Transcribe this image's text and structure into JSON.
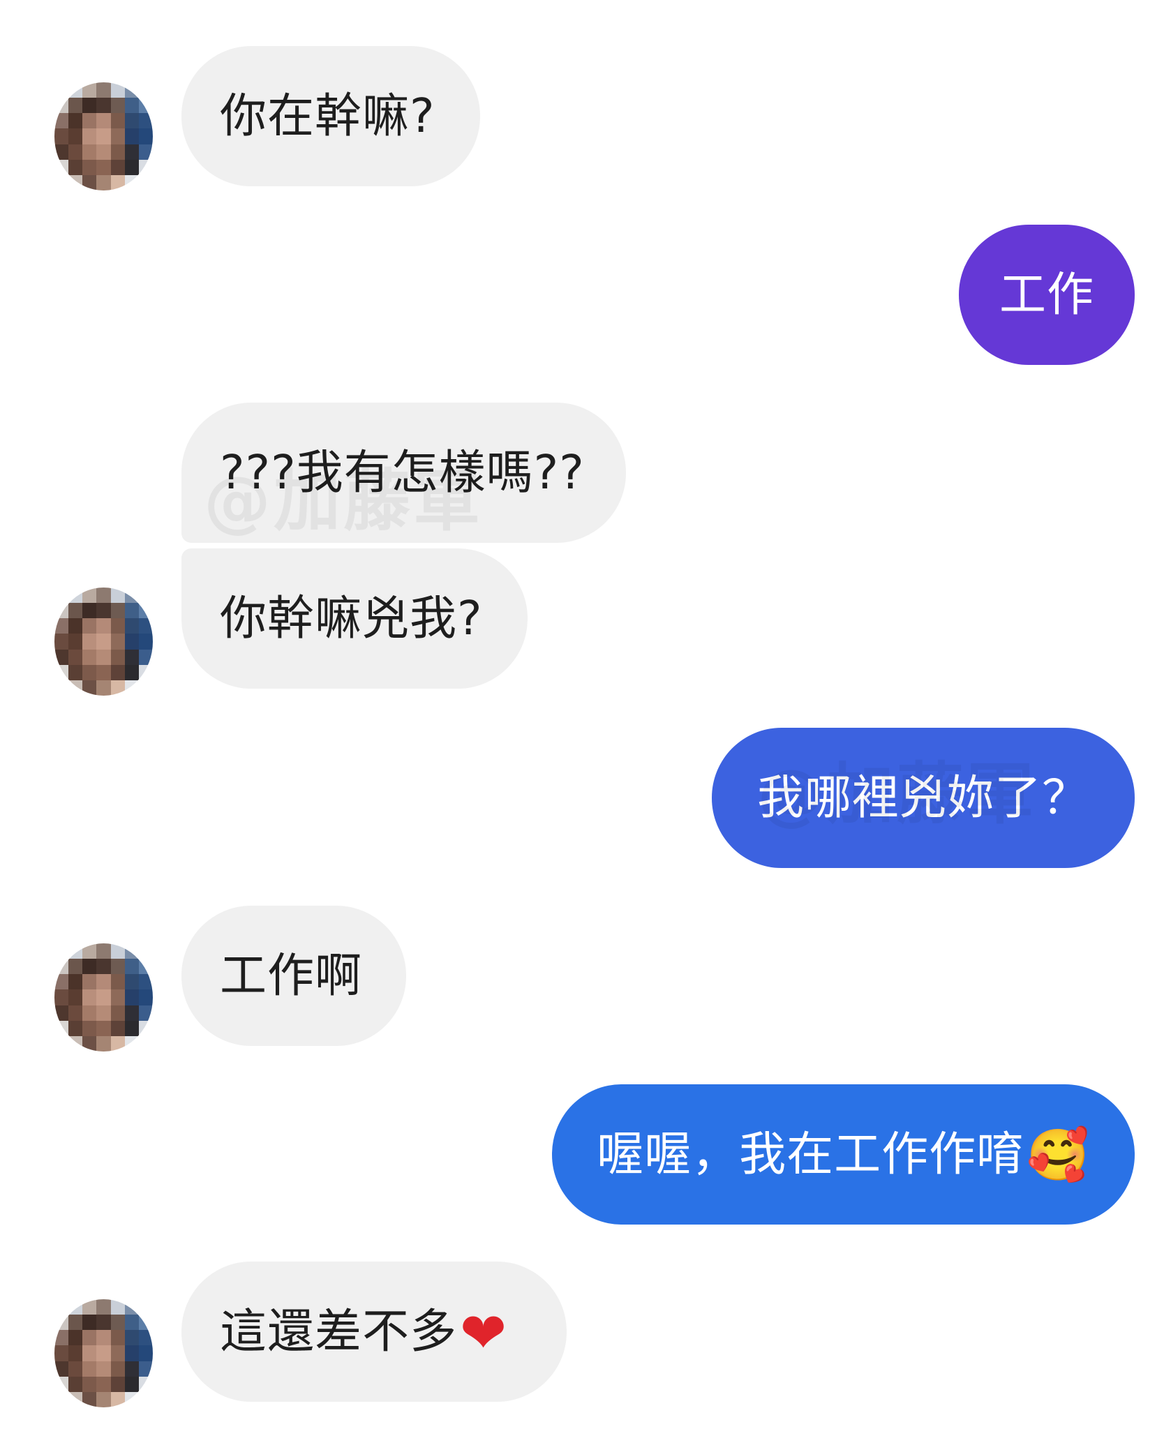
{
  "messages": [
    {
      "side": "in",
      "text": "你在幹嘛?"
    },
    {
      "side": "out",
      "text": "工作",
      "color": "#6538d6"
    },
    {
      "side": "in",
      "text": "???我有怎樣嗎??"
    },
    {
      "side": "in",
      "text": "你幹嘛兇我?"
    },
    {
      "side": "out",
      "text": "我哪裡兇妳了？",
      "color": "#3c62e0"
    },
    {
      "side": "in",
      "text": "工作啊"
    },
    {
      "side": "out",
      "text": "喔喔，我在工作作唷",
      "emoji": "🥰",
      "color": "#2a72e6"
    },
    {
      "side": "in",
      "text": "這還差不多",
      "emoji": "❤"
    }
  ],
  "watermark": "@加藤軍",
  "colors": {
    "incoming_bubble": "#f0f0f0",
    "incoming_text": "#1e1e1e",
    "background": "#ffffff"
  },
  "avatar_icon": "pixelated-avatar"
}
